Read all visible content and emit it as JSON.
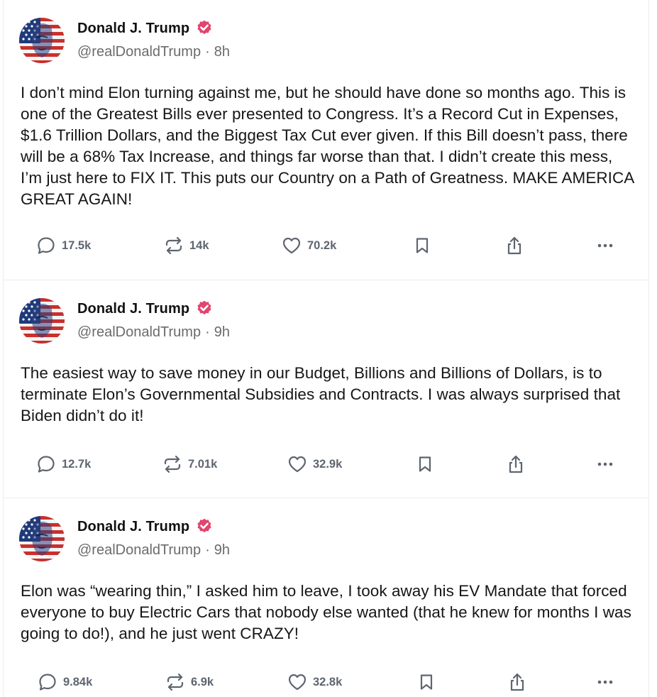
{
  "colors": {
    "verified_badge": "#e0466e",
    "icon_gray": "#5e6570",
    "divider": "#ececec"
  },
  "icons": {
    "reply": "speech-bubble",
    "retruth": "repost-arrows",
    "like": "heart",
    "bookmark": "bookmark",
    "share": "share-upload",
    "more": "ellipsis"
  },
  "posts": [
    {
      "author": "Donald J. Trump",
      "handle": "@realDonaldTrump",
      "separator": "·",
      "time": "8h",
      "text": "I don’t mind Elon turning against me, but he should have done so months ago. This is one of the Greatest Bills ever presented to Congress. It’s a Record Cut in Expenses, $1.6 Trillion Dollars, and the Biggest Tax Cut ever given. If this Bill doesn’t pass, there will be a 68% Tax Increase, and things far worse than that. I didn’t create this mess, I’m just here to FIX IT. This puts our Country on a Path of Greatness. MAKE AMERICA GREAT AGAIN!",
      "replies": "17.5k",
      "retruths": "14k",
      "likes": "70.2k"
    },
    {
      "author": "Donald J. Trump",
      "handle": "@realDonaldTrump",
      "separator": "·",
      "time": "9h",
      "text": "The easiest way to save money in our Budget, Billions and Billions of Dollars, is to terminate Elon’s Governmental Subsidies and Contracts. I was always surprised that Biden didn’t do it!",
      "replies": "12.7k",
      "retruths": "7.01k",
      "likes": "32.9k"
    },
    {
      "author": "Donald J. Trump",
      "handle": "@realDonaldTrump",
      "separator": "·",
      "time": "9h",
      "text": "Elon was “wearing thin,” I asked him to leave, I took away his EV Mandate that forced everyone to buy Electric Cars that nobody else wanted (that he knew for months I was going to do!), and he just went CRAZY!",
      "replies": "9.84k",
      "retruths": "6.9k",
      "likes": "32.8k"
    }
  ]
}
